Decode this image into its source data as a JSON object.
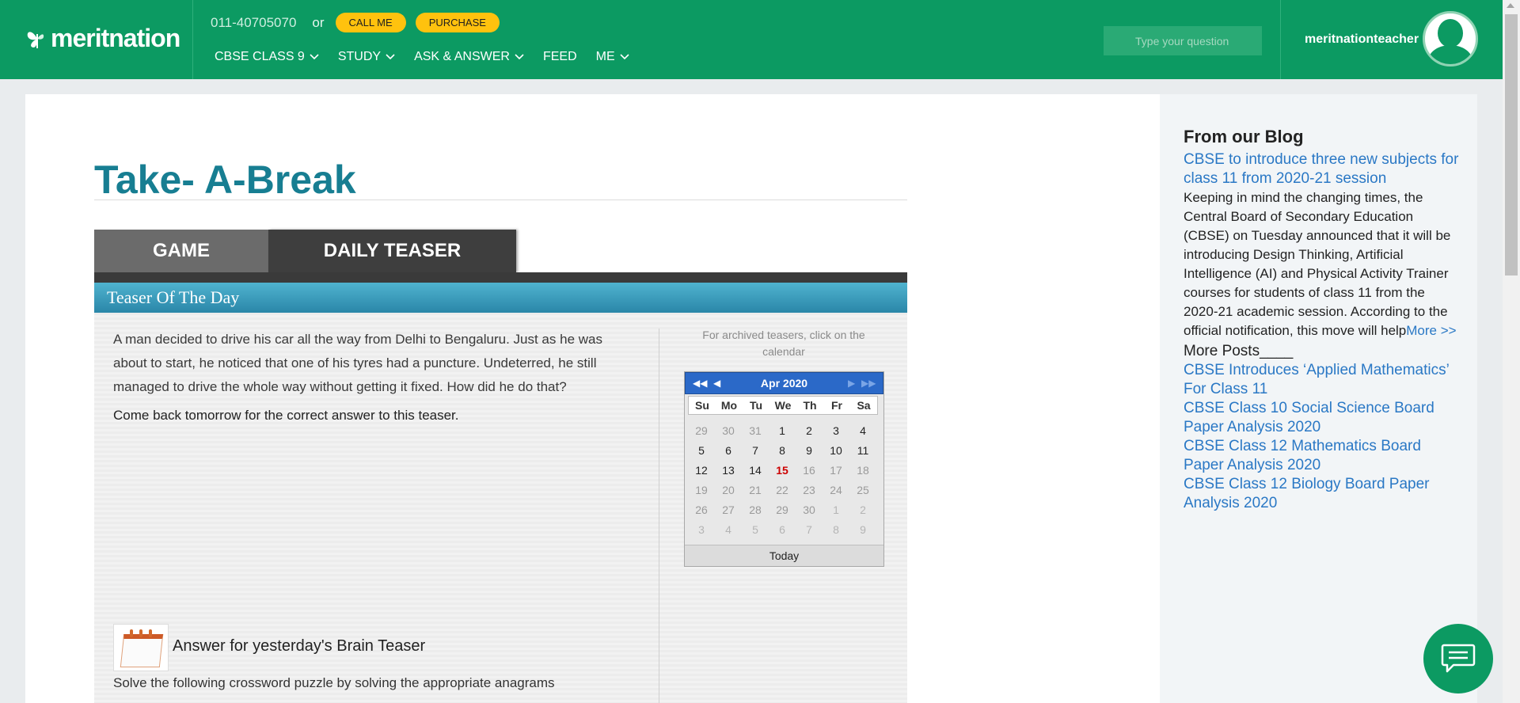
{
  "header": {
    "logo_text": "meritnation",
    "phone": "011-40705070",
    "or_text": "or",
    "call_label": "CALL ME",
    "purchase_label": "PURCHASE",
    "nav": [
      {
        "label": "CBSE CLASS 9"
      },
      {
        "label": "STUDY"
      },
      {
        "label": "ASK & ANSWER"
      },
      {
        "label": "FEED"
      },
      {
        "label": "ME"
      }
    ],
    "search_placeholder": "Type your question",
    "username": "meritnationteacher"
  },
  "main": {
    "title": "Take- A-Break",
    "tabs": {
      "game": "GAME",
      "daily_teaser": "DAILY TEASER"
    },
    "teaser_heading": "Teaser Of The Day",
    "question": "A man decided to drive his car all the way from Delhi to Bengaluru. Just as he was about to start, he noticed that one of his tyres had a puncture. Undeterred, he still managed to drive the whole way without getting it fixed. How did he do that?",
    "come_back": "Come back tomorrow for the correct answer to this teaser.",
    "answer_title": "Answer for yesterday's Brain Teaser",
    "answer_sub": "Solve the following crossword puzzle by solving the appropriate anagrams",
    "archive_note": "For archived teasers, click on the calendar"
  },
  "calendar": {
    "month": "Apr 2020",
    "prev_year": "◀◀",
    "prev_month": "◀",
    "next_month": "▶",
    "next_year": "▶▶",
    "weekdays": [
      "Su",
      "Mo",
      "Tu",
      "We",
      "Th",
      "Fr",
      "Sa"
    ],
    "days": [
      {
        "d": "29",
        "t": "other"
      },
      {
        "d": "30",
        "t": "other"
      },
      {
        "d": "31",
        "t": "other"
      },
      {
        "d": "1",
        "t": ""
      },
      {
        "d": "2",
        "t": ""
      },
      {
        "d": "3",
        "t": ""
      },
      {
        "d": "4",
        "t": ""
      },
      {
        "d": "5",
        "t": ""
      },
      {
        "d": "6",
        "t": ""
      },
      {
        "d": "7",
        "t": ""
      },
      {
        "d": "8",
        "t": ""
      },
      {
        "d": "9",
        "t": ""
      },
      {
        "d": "10",
        "t": ""
      },
      {
        "d": "11",
        "t": ""
      },
      {
        "d": "12",
        "t": ""
      },
      {
        "d": "13",
        "t": ""
      },
      {
        "d": "14",
        "t": ""
      },
      {
        "d": "15",
        "t": "today"
      },
      {
        "d": "16",
        "t": "future"
      },
      {
        "d": "17",
        "t": "future"
      },
      {
        "d": "18",
        "t": "future"
      },
      {
        "d": "19",
        "t": "future"
      },
      {
        "d": "20",
        "t": "future"
      },
      {
        "d": "21",
        "t": "future"
      },
      {
        "d": "22",
        "t": "future"
      },
      {
        "d": "23",
        "t": "future"
      },
      {
        "d": "24",
        "t": "future"
      },
      {
        "d": "25",
        "t": "future"
      },
      {
        "d": "26",
        "t": "future"
      },
      {
        "d": "27",
        "t": "future"
      },
      {
        "d": "28",
        "t": "future"
      },
      {
        "d": "29",
        "t": "future"
      },
      {
        "d": "30",
        "t": "future"
      },
      {
        "d": "1",
        "t": "out"
      },
      {
        "d": "2",
        "t": "out"
      },
      {
        "d": "3",
        "t": "out"
      },
      {
        "d": "4",
        "t": "out"
      },
      {
        "d": "5",
        "t": "out"
      },
      {
        "d": "6",
        "t": "out"
      },
      {
        "d": "7",
        "t": "out"
      },
      {
        "d": "8",
        "t": "out"
      },
      {
        "d": "9",
        "t": "out"
      }
    ],
    "today_label": "Today"
  },
  "blog": {
    "heading": "From our Blog",
    "featured_title": "CBSE to introduce three new subjects for class 11 from 2020-21 session",
    "featured_text": "Keeping in mind the changing times, the Central Board of Secondary Education (CBSE) on Tuesday announced that it will be introducing Design Thinking, Artificial Intelligence (AI) and Physical Activity Trainer courses for students of class 11 from the 2020-21 academic session. According to the official notification, this move will help",
    "more_label": "More >>",
    "more_posts_label": "More Posts____",
    "posts": [
      {
        "title": "CBSE Introduces ‘Applied Mathematics’ For Class 11"
      },
      {
        "title": "CBSE Class 10 Social Science Board Paper Analysis 2020"
      },
      {
        "title": "CBSE Class 12 Mathematics Board Paper Analysis 2020"
      },
      {
        "title": "CBSE Class 12 Biology Board Paper Analysis 2020"
      }
    ]
  },
  "colors": {
    "brand_green": "#0c9a62",
    "title_teal": "#177e92",
    "accent_yellow": "#ffc20e",
    "link_blue": "#2a78c5"
  },
  "icons": {
    "chat": "chat-bubble-icon",
    "avatar": "user-avatar-icon",
    "logo": "butterfly-logo-icon",
    "dropdown": "chevron-down-icon"
  }
}
